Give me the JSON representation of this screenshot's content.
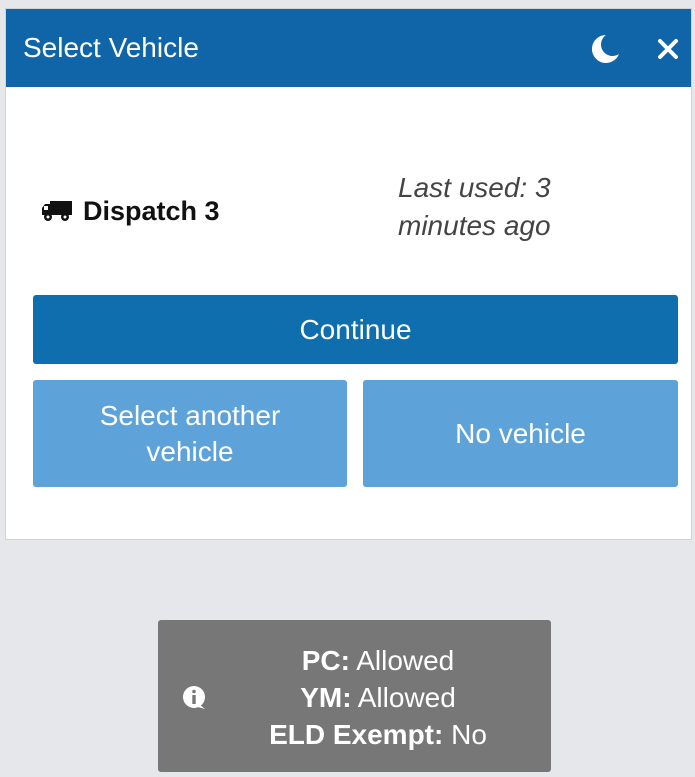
{
  "header": {
    "title": "Select Vehicle",
    "theme_icon": "moon-icon",
    "close_icon": "close-icon"
  },
  "vehicle": {
    "icon": "truck-icon",
    "name": "Dispatch 3",
    "last_used": "Last used: 3 minutes ago"
  },
  "actions": {
    "continue_label": "Continue",
    "select_another_label": "Select another vehicle",
    "no_vehicle_label": "No vehicle"
  },
  "info": {
    "icon": "info-icon",
    "rows": [
      {
        "key": "PC:",
        "value": "Allowed"
      },
      {
        "key": "YM:",
        "value": "Allowed"
      },
      {
        "key": "ELD Exempt:",
        "value": "No"
      }
    ]
  },
  "colors": {
    "header_bg": "#0f65a7",
    "primary_button": "#0f6ead",
    "secondary_button": "#5da3d9",
    "info_bg": "#777777",
    "page_bg": "#e6e7ea"
  }
}
